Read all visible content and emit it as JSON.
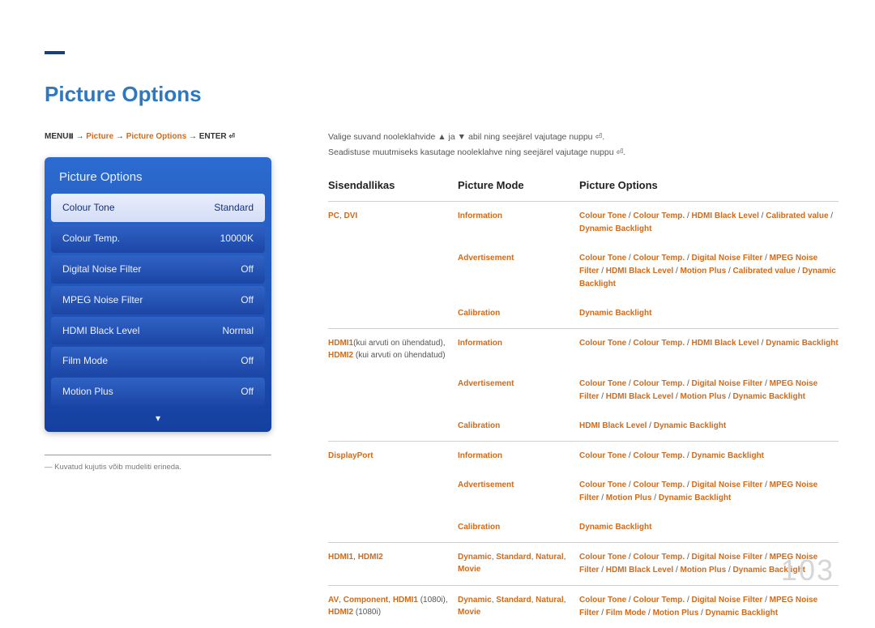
{
  "title": "Picture Options",
  "breadcrumb": {
    "menu": "MENU",
    "menu_icon": "Ⅲ",
    "arrow": "→",
    "p1": "Picture",
    "p2": "Picture Options",
    "enter": "ENTER",
    "enter_icon": "⏎"
  },
  "panel": {
    "title": "Picture Options",
    "rows": [
      {
        "label": "Colour Tone",
        "value": "Standard",
        "selected": true
      },
      {
        "label": "Colour Temp.",
        "value": "10000K"
      },
      {
        "label": "Digital Noise Filter",
        "value": "Off"
      },
      {
        "label": "MPEG Noise Filter",
        "value": "Off"
      },
      {
        "label": "HDMI Black Level",
        "value": "Normal"
      },
      {
        "label": "Film Mode",
        "value": "Off"
      },
      {
        "label": "Motion Plus",
        "value": "Off"
      }
    ],
    "chevron": "▾"
  },
  "footnote_dash": "―",
  "footnote": "Kuvatud kujutis võib mudeliti erineda.",
  "intro1_a": "Valige suvand nooleklahvide ",
  "intro1_up": "▲",
  "intro1_mid": " ja ",
  "intro1_down": "▼",
  "intro1_b": " abil ning seejärel vajutage nuppu ",
  "intro1_icon": "⏎",
  "intro2_a": "Seadistuse muutmiseks kasutage nooleklahve ning seejärel vajutage nuppu ",
  "intro2_icon": "⏎",
  "period": ".",
  "headers": {
    "c1": "Sisendallikas",
    "c2": "Picture Mode",
    "c3": "Picture Options"
  },
  "table": [
    {
      "c1": [
        {
          "t": "PC",
          "o": true
        },
        {
          "t": ", ",
          "o": false
        },
        {
          "t": "DVI",
          "o": true
        }
      ],
      "groups": [
        {
          "mode": "Information",
          "opts": "Colour Tone / Colour Temp. / HDMI Black Level / Calibrated value / Dynamic Backlight"
        },
        {
          "mode": "Advertisement",
          "opts": "Colour Tone / Colour Temp. / Digital Noise Filter / MPEG Noise Filter / HDMI Black Level / Motion Plus / Calibrated value / Dynamic Backlight"
        },
        {
          "mode": "Calibration",
          "opts": "Dynamic Backlight"
        }
      ]
    },
    {
      "c1": [
        {
          "t": "HDMI1",
          "o": true
        },
        {
          "t": "(kui arvuti on ühendatud), ",
          "o": false
        },
        {
          "t": "HDMI2",
          "o": true
        },
        {
          "t": " (kui arvuti on ühendatud)",
          "o": false
        }
      ],
      "groups": [
        {
          "mode": "Information",
          "opts": "Colour Tone / Colour Temp. / HDMI Black Level / Dynamic Backlight"
        },
        {
          "mode": "Advertisement",
          "opts": "Colour Tone / Colour Temp. / Digital Noise Filter / MPEG Noise Filter / HDMI Black Level / Motion Plus / Dynamic Backlight"
        },
        {
          "mode": "Calibration",
          "opts": "HDMI Black Level / Dynamic Backlight"
        }
      ]
    },
    {
      "c1": [
        {
          "t": "DisplayPort",
          "o": true
        }
      ],
      "groups": [
        {
          "mode": "Information",
          "opts": "Colour Tone / Colour Temp. / Dynamic Backlight"
        },
        {
          "mode": "Advertisement",
          "opts": "Colour Tone / Colour Temp. / Digital Noise Filter / MPEG Noise Filter / Motion Plus / Dynamic Backlight"
        },
        {
          "mode": "Calibration",
          "opts": "Dynamic Backlight"
        }
      ]
    },
    {
      "c1": [
        {
          "t": "HDMI1",
          "o": true
        },
        {
          "t": ", ",
          "o": false
        },
        {
          "t": "HDMI2",
          "o": true
        }
      ],
      "groups": [
        {
          "mode": "Dynamic, Standard, Natural, Movie",
          "mode_parts": [
            {
              "t": "Dynamic",
              "o": true
            },
            {
              "t": ", ",
              "o": false
            },
            {
              "t": "Standard",
              "o": true
            },
            {
              "t": ", ",
              "o": false
            },
            {
              "t": "Natural",
              "o": true
            },
            {
              "t": ", ",
              "o": false
            },
            {
              "t": "Movie",
              "o": true
            }
          ],
          "opts": "Colour Tone / Colour Temp. / Digital Noise Filter / MPEG Noise Filter / HDMI Black Level / Motion Plus / Dynamic Backlight"
        }
      ]
    },
    {
      "c1": [
        {
          "t": "AV",
          "o": true
        },
        {
          "t": ", ",
          "o": false
        },
        {
          "t": "Component",
          "o": true
        },
        {
          "t": ", ",
          "o": false
        },
        {
          "t": "HDMI1",
          "o": true
        },
        {
          "t": " (1080i), ",
          "o": false
        },
        {
          "t": "HDMI2",
          "o": true
        },
        {
          "t": " (1080i)",
          "o": false
        }
      ],
      "groups": [
        {
          "mode": "Dynamic, Standard, Natural, Movie",
          "mode_parts": [
            {
              "t": "Dynamic",
              "o": true
            },
            {
              "t": ", ",
              "o": false
            },
            {
              "t": "Standard",
              "o": true
            },
            {
              "t": ", ",
              "o": false
            },
            {
              "t": "Natural",
              "o": true
            },
            {
              "t": ", ",
              "o": false
            },
            {
              "t": "Movie",
              "o": true
            }
          ],
          "opts": "Colour Tone / Colour Temp. / Digital Noise Filter / MPEG Noise Filter / Film Mode / Motion Plus / Dynamic Backlight"
        }
      ]
    }
  ],
  "page_number": "103"
}
